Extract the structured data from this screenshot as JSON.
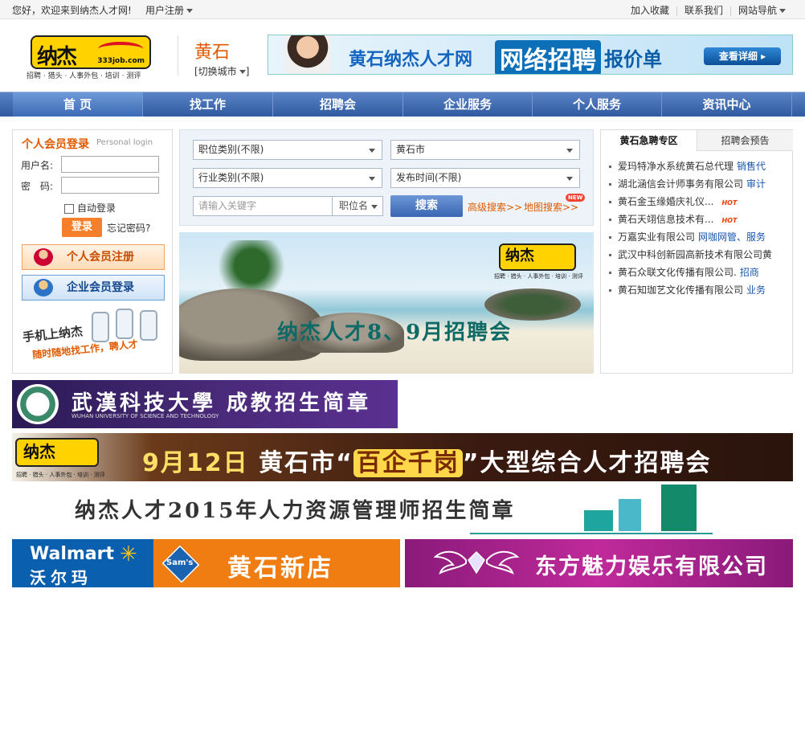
{
  "topbar": {
    "welcome": "您好，欢迎来到纳杰人才网!",
    "register": "用户注册",
    "links": [
      "加入收藏",
      "联系我们",
      "网站导航"
    ]
  },
  "header": {
    "logo_mark": "纳杰",
    "logo_site": "333job.com",
    "tagline": "招聘 · 猎头 · 人事外包 · 培训 · 测评",
    "city": "黄石",
    "switch_city": "[切换城市",
    "switch_city_end": "]",
    "ad": {
      "t1": "黄石纳杰人才网",
      "t2": "网络招聘",
      "t3": "报价单",
      "button": "查看详细 ▸"
    }
  },
  "nav": {
    "items": [
      "首 页",
      "找工作",
      "招聘会",
      "企业服务",
      "个人服务",
      "资讯中心"
    ]
  },
  "login": {
    "title": "个人会员登录",
    "title_en": "Personal login",
    "username_label": "用户名:",
    "password_label": "密　码:",
    "auto_login": "自动登录",
    "login_button": "登录",
    "forgot": "忘记密码?",
    "personal_register": "个人会员注册",
    "company_login": "企业会员登录",
    "mobile_line1": "手机上纳杰",
    "mobile_line2": "随时随地找工作，聘人才"
  },
  "search": {
    "job_category": "职位类别(不限)",
    "city": "黄石市",
    "industry": "行业类别(不限)",
    "publish_time": "发布时间(不限)",
    "keyword_placeholder": "请输入关键字",
    "keyword_type": "职位名",
    "search_button": "搜索",
    "advanced": "高级搜索>>",
    "map": "地图搜索>>",
    "new_badge": "NEW"
  },
  "beach_banner": {
    "logo": "纳杰",
    "logo_sub": "招聘 · 猎头 · 人事外包 · 培训 · 测评",
    "slogan": "纳杰人才8、9月招聘会"
  },
  "right_panel": {
    "tab_active": "黄石急聘专区",
    "tab_other": "招聘会预告",
    "items": [
      {
        "name": "爱玛特净水系统黄石总代理",
        "tag": "销售代",
        "hot": ""
      },
      {
        "name": "湖北涵信会计师事务有限公司",
        "tag": "审计",
        "hot": ""
      },
      {
        "name": "黄石金玉缘婚庆礼仪...",
        "tag": "",
        "hot": "HOT"
      },
      {
        "name": "黄石天翊信息技术有...",
        "tag": "",
        "hot": "HOT"
      },
      {
        "name": "万嘉实业有限公司",
        "tag": "网咖网管、服务",
        "hot": ""
      },
      {
        "name": "武汉中科创新园高新技术有限公司黄",
        "tag": "",
        "hot": ""
      },
      {
        "name": "黄石众联文化传播有限公司.",
        "tag": "招商",
        "hot": ""
      },
      {
        "name": "黄石知珈艺文化传播有限公司",
        "tag": "业务",
        "hot": ""
      }
    ]
  },
  "banners": {
    "wust_title": "武漢科技大學 成教招生简章",
    "wust_en": "WUHAN UNIVERSITY OF SCIENCE AND TECHNOLOGY",
    "fair_logo": "纳杰",
    "fair_logo_sub": "招聘 · 猎头 · 人事外包 · 培训 · 测评",
    "fair_date": "9月12日",
    "fair_city": "黄石市“",
    "fair_highlight": "百企千岗",
    "fair_rest": "”大型综合人才招聘会",
    "hr_title": "纳杰人才2015年人力资源管理师招生简章",
    "walmart_en": "Walmart",
    "walmart_cn": "沃尔玛",
    "walmart_star": "✳",
    "sams": "Sam's",
    "walmart_store": "黄石新店",
    "dongfang": "东方魅力娱乐有限公司"
  },
  "colors": {
    "accent_orange": "#e05a00",
    "nav_blue": "#2f5aa0",
    "link_blue": "#1a56b0"
  }
}
